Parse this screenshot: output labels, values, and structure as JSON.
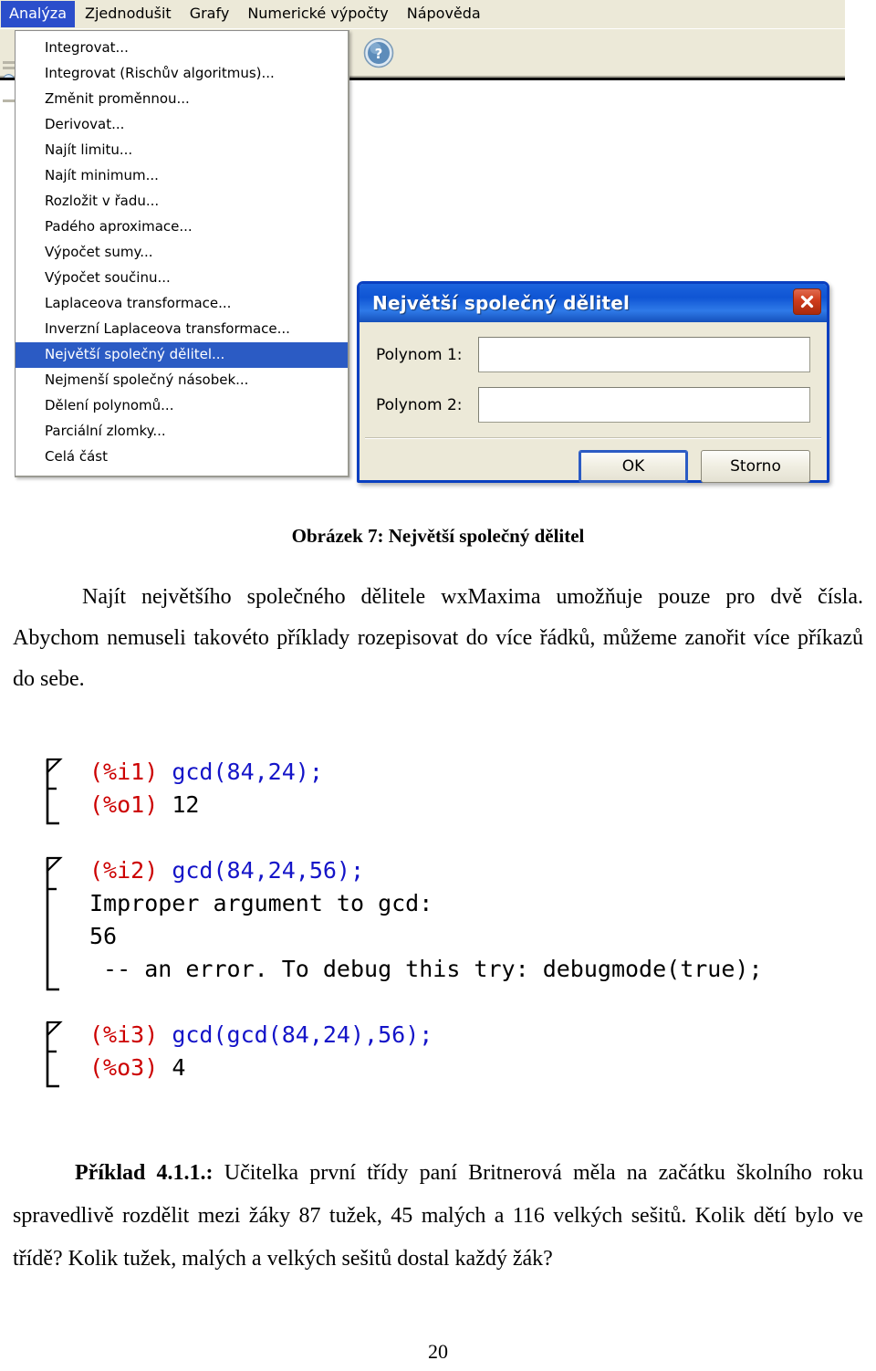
{
  "app": {
    "menubar": [
      {
        "label": "Analýza",
        "active": true
      },
      {
        "label": "Zjednodušit",
        "active": false
      },
      {
        "label": "Grafy",
        "active": false
      },
      {
        "label": "Numerické výpočty",
        "active": false
      },
      {
        "label": "Nápověda",
        "active": false
      }
    ],
    "toolbar": {
      "help_icon": "help-question-icon",
      "help_glyph": "?"
    },
    "dropdown": {
      "items": [
        {
          "label": "Integrovat...",
          "selected": false
        },
        {
          "label": "Integrovat (Rischův algoritmus)...",
          "selected": false
        },
        {
          "label": "Změnit proměnnou...",
          "selected": false
        },
        {
          "label": "Derivovat...",
          "selected": false
        },
        {
          "label": "Najít limitu...",
          "selected": false
        },
        {
          "label": "Najít minimum...",
          "selected": false
        },
        {
          "label": "Rozložit v řadu...",
          "selected": false
        },
        {
          "label": "Padého aproximace...",
          "selected": false
        },
        {
          "label": "Výpočet sumy...",
          "selected": false
        },
        {
          "label": "Výpočet součinu...",
          "selected": false
        },
        {
          "label": "Laplaceova transformace...",
          "selected": false
        },
        {
          "label": "Inverzní Laplaceova transformace...",
          "selected": false
        },
        {
          "label": "Největší společný dělitel...",
          "selected": true
        },
        {
          "label": "Nejmenší společný násobek...",
          "selected": false
        },
        {
          "label": "Dělení polynomů...",
          "selected": false
        },
        {
          "label": "Parciální zlomky...",
          "selected": false
        },
        {
          "label": "Celá část",
          "selected": false
        }
      ]
    },
    "dialog": {
      "title": "Největší společný dělitel",
      "close_icon": "close-x-icon",
      "fields": [
        {
          "label": "Polynom 1:",
          "value": "",
          "placeholder": ""
        },
        {
          "label": "Polynom 2:",
          "value": "",
          "placeholder": ""
        }
      ],
      "ok_label": "OK",
      "cancel_label": "Storno"
    },
    "colors": {
      "menu_highlight": "#2b5bc4",
      "menubar_active": "#2b4ecb",
      "dialog_border": "#0a3fc0",
      "dialog_face": "#ece9d8",
      "close_button": "#cf3c1c",
      "prompt_red": "#cc0000",
      "expression_blue": "#1414c8"
    }
  },
  "document": {
    "figure_caption": "Obrázek 7: Největší společný dělitel",
    "paragraph_1": "Najít největšího společného dělitele wxMaxima umožňuje pouze pro dvě čísla. Abychom nemuseli takovéto příklady rozepisovat do více řádků, můžeme zanořit více příkazů do sebe.",
    "example_label": "Příklad 4.1.1.:",
    "paragraph_2": " Učitelka první třídy paní Britnerová měla na začátku školního roku spravedlivě rozdělit mezi žáky 87 tužek, 45 malých a 116 velkých sešitů. Kolik dětí bylo ve třídě? Kolik tužek, malých a velkých sešitů dostal každý žák?",
    "page_number": "20"
  },
  "console": {
    "cells": [
      {
        "lines": [
          {
            "prompt": "(%i1)",
            "expr": " gcd(84,24);",
            "plain": ""
          }
        ],
        "output": [
          {
            "prompt": "(%o1)",
            "expr": "",
            "plain": " 12"
          }
        ]
      },
      {
        "lines": [
          {
            "prompt": "(%i2)",
            "expr": " gcd(84,24,56);",
            "plain": ""
          }
        ],
        "output": [
          {
            "prompt": "",
            "expr": "",
            "plain": "Improper argument to gcd:"
          },
          {
            "prompt": "",
            "expr": "",
            "plain": "56"
          },
          {
            "prompt": "",
            "expr": "",
            "plain": " -- an error. To debug this try: debugmode(true);"
          }
        ]
      },
      {
        "lines": [
          {
            "prompt": "(%i3)",
            "expr": " gcd(gcd(84,24),56);",
            "plain": ""
          }
        ],
        "output": [
          {
            "prompt": "(%o3)",
            "expr": "",
            "plain": " 4"
          }
        ]
      }
    ]
  }
}
